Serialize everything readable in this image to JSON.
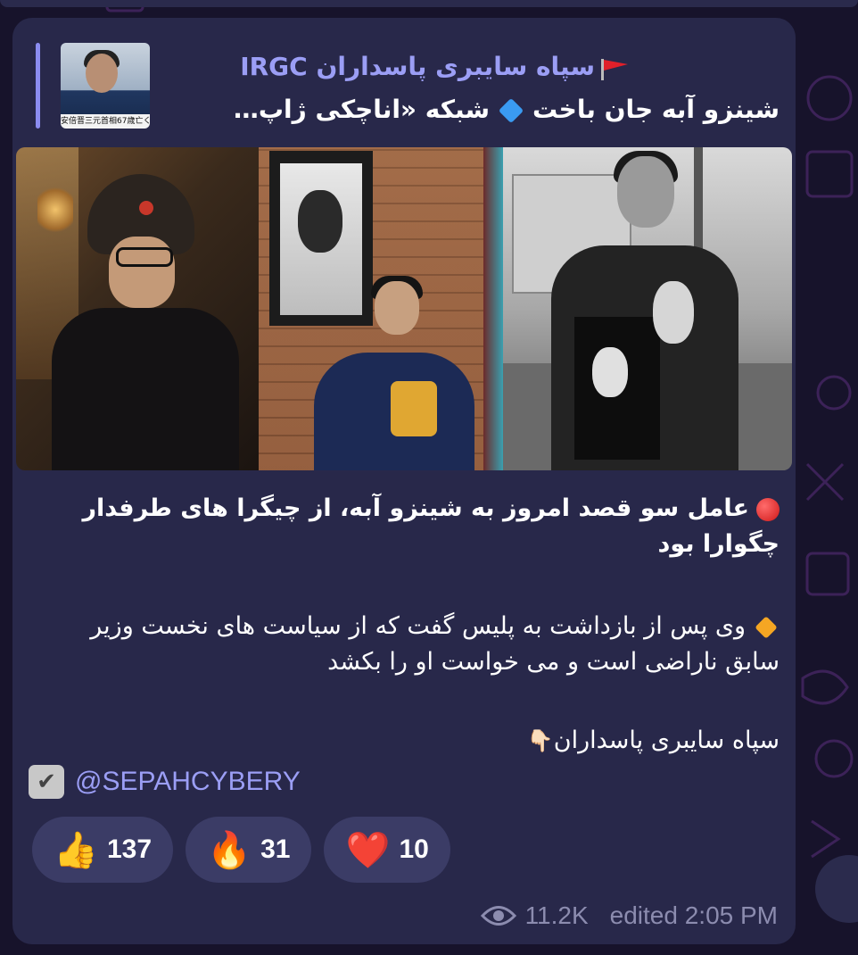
{
  "reply": {
    "title": "سپاه سایبری پاسداران IRGC",
    "flag_icon": "red-flag-icon",
    "text": "شینزو آبه جان باخت",
    "text_rest": "شبکه «اناچکی ژاپ…",
    "thumb_caption": "安倍晋三元首相67歳亡く"
  },
  "message": {
    "line1": "عامل سو قصد امروز به شینزو آبه، از چیگرا های طرفدار چگوارا بود",
    "line2": "وی پس از بازداشت به پلیس گفت که از سیاست های نخست وزیر سابق ناراضی است و می خواست او را بکشد",
    "line3": "سپاه سایبری پاسداران",
    "line3_emoji": "👇🏻"
  },
  "handle": "@SEPAHCYBERY",
  "reactions": [
    {
      "emoji": "👍",
      "count": "137",
      "icon": "thumbs-up-icon"
    },
    {
      "emoji": "🔥",
      "count": "31",
      "icon": "fire-icon"
    },
    {
      "emoji": "❤️",
      "count": "10",
      "icon": "heart-icon"
    }
  ],
  "footer": {
    "views": "11.2K",
    "edited": "edited 2:05 PM"
  },
  "colors": {
    "background": "#17132b",
    "bubble": "#28284a",
    "accent": "#9b9ef5",
    "reaction_bg": "#3b3c66",
    "meta": "#8c8caf"
  }
}
